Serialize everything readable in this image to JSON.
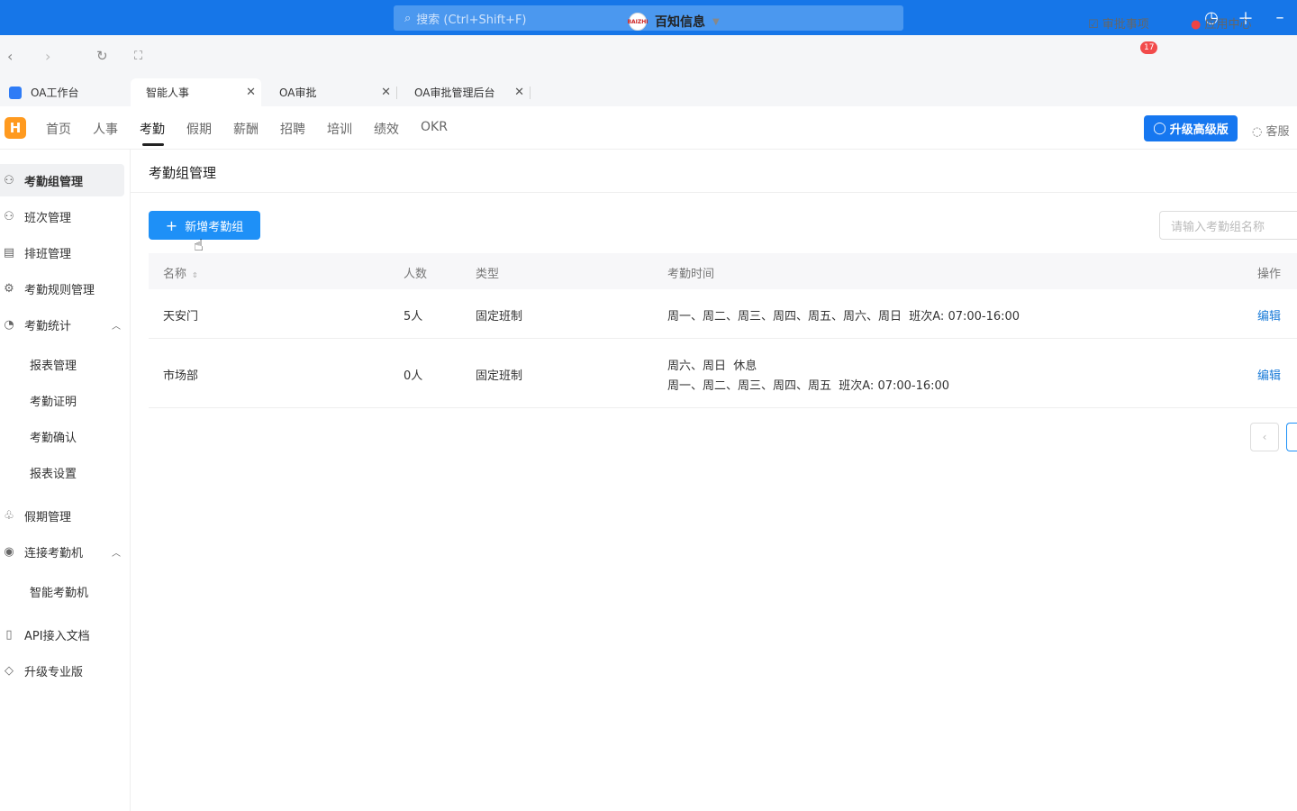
{
  "topbar": {
    "search_placeholder": "搜索 (Ctrl+Shift+F)"
  },
  "navbar": {
    "org_name": "百知信息",
    "org_logo_text": "BAIZHI",
    "approvals_label": "审批事项",
    "approvals_count": "17",
    "app_center_label": "应用中心"
  },
  "tabs": [
    {
      "label": "OA工作台"
    },
    {
      "label": "智能人事"
    },
    {
      "label": "OA审批"
    },
    {
      "label": "OA审批管理后台"
    }
  ],
  "menu": {
    "logo": "H",
    "items": [
      "首页",
      "人事",
      "考勤",
      "假期",
      "薪酬",
      "招聘",
      "培训",
      "绩效",
      "OKR"
    ],
    "upgrade_label": "升级高级版",
    "service_label": "客服"
  },
  "sidebar": {
    "items": {
      "group": "考勤组管理",
      "shift": "班次管理",
      "schedule": "排班管理",
      "rules": "考勤规则管理",
      "stats": "考勤统计",
      "holiday": "假期管理",
      "connect": "连接考勤机",
      "api": "API接入文档",
      "pro": "升级专业版"
    },
    "stats_sub": [
      "报表管理",
      "考勤证明",
      "考勤确认",
      "报表设置"
    ],
    "connect_sub": [
      "智能考勤机"
    ]
  },
  "page": {
    "title": "考勤组管理",
    "add_button": "新增考勤组",
    "search_placeholder": "请输入考勤组名称"
  },
  "table": {
    "headers": {
      "name": "名称",
      "count": "人数",
      "type": "类型",
      "time": "考勤时间",
      "action": "操作"
    },
    "rows": [
      {
        "name": "天安门",
        "count": "5人",
        "type": "固定班制",
        "time1": "周一、周二、周三、周四、周五、周六、周日  班次A: 07:00-16:00",
        "time2": "",
        "action": "编辑"
      },
      {
        "name": "市场部",
        "count": "0人",
        "type": "固定班制",
        "time1": "周六、周日  休息",
        "time2": "周一、周二、周三、周四、周五  班次A: 07:00-16:00",
        "action": "编辑"
      }
    ]
  }
}
